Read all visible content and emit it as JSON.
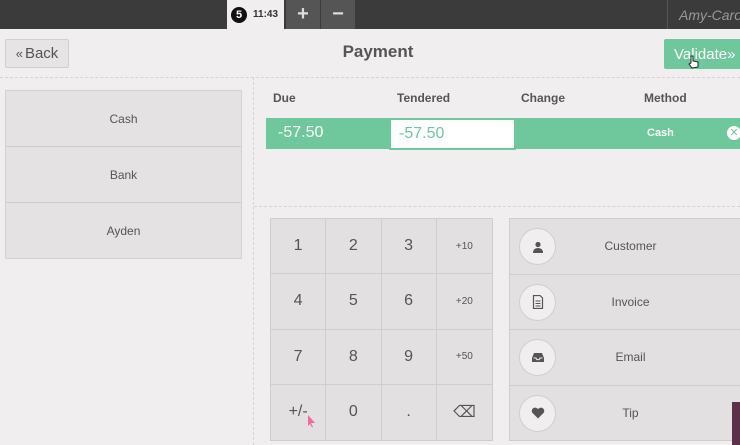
{
  "topbar": {
    "order_number": "5",
    "order_time": "11:43",
    "add_label": "+",
    "remove_label": "−",
    "user_name": "Amy-Caro"
  },
  "header": {
    "back_label": "Back",
    "back_icon": "«",
    "title": "Payment",
    "validate_label": "Validate",
    "validate_icon": "»"
  },
  "payment_methods": [
    "Cash",
    "Bank",
    "Ayden"
  ],
  "paymentlines": {
    "columns": [
      "Due",
      "Tendered",
      "Change",
      "Method"
    ],
    "lines": [
      {
        "due": "-57.50",
        "tendered": "-57.50",
        "change": "",
        "method": "Cash"
      }
    ]
  },
  "numpad": {
    "keys": [
      "1",
      "2",
      "3",
      "+10",
      "4",
      "5",
      "6",
      "+20",
      "7",
      "8",
      "9",
      "+50",
      "+/-",
      "0",
      ".",
      "⌫"
    ]
  },
  "actions": [
    {
      "label": "Customer",
      "icon": "person-icon"
    },
    {
      "label": "Invoice",
      "icon": "document-icon"
    },
    {
      "label": "Email",
      "icon": "inbox-icon"
    },
    {
      "label": "Tip",
      "icon": "heart-icon"
    }
  ],
  "colors": {
    "accent": "#6ec89b",
    "topbar": "#3b3b3b",
    "background": "#f0eeee"
  }
}
